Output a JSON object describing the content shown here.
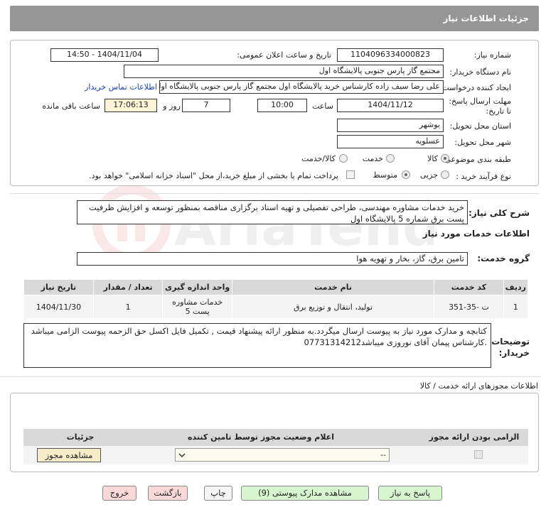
{
  "header": {
    "title": "جزئیات اطلاعات نیاز"
  },
  "form": {
    "need_number_label": "شماره نیاز:",
    "need_number": "1104096334000823",
    "announce_label": "تاریخ و ساعت اعلان عمومی:",
    "announce_value": "1404/11/04 - 14:50",
    "buyer_org_label": "نام دستگاه خریدار:",
    "buyer_org": "مجتمع گاز پارس جنوبی  پالایشگاه اول",
    "creator_label": "ایجاد کننده درخواست:",
    "creator": "علی رضا سیف زاده کارشناس خرید پالایشگاه اول مجتمع گاز پارس جنوبی  پالایشگاه اول",
    "contact_link": "اطلاعات تماس خریدار",
    "deadline_label": "مهلت ارسال پاسخ: تا تاریخ:",
    "deadline_date": "1404/11/12",
    "time_label": "ساعت",
    "deadline_time": "10:00",
    "days": "7",
    "days_label": "روز و",
    "remaining_time": "17:06:13",
    "remaining_label": "ساعت باقی مانده",
    "province_label": "استان محل تحویل:",
    "province": "بوشهر",
    "city_label": "شهر محل تحویل:",
    "city": "عسلویه",
    "category_label": "طبقه بندی موضوعی:",
    "category_options": [
      "کالا",
      "خدمت",
      "کالا/خدمت"
    ],
    "purchase_type_label": "نوع فرآیند خرید :",
    "purchase_options": [
      "جزیی",
      "متوسط"
    ],
    "payment_note": "پرداخت تمام یا بخشی از مبلغ خرید،از محل \"اسناد خزانه اسلامی\" خواهد بود."
  },
  "description": {
    "label": "شرح کلی نیاز:",
    "text": "خرید خدمات مشاوره مهندسی، طراحی تفصیلی و تهیه اسناد برگزاری مناقصه بمنظور توسعه و افزایش ظرفیت پست برق شماره 5 پالایشگاه اول"
  },
  "services": {
    "section_title": "اطلاعات خدمات مورد نیاز",
    "group_label": "گروه خدمت:",
    "group_value": "تامین برق، گاز، بخار و تهویه هوا",
    "headers": [
      "ردیف",
      "کد خدمت",
      "نام خدمت",
      "واحد اندازه گیری",
      "تعداد / مقدار",
      "تاریخ نیاز"
    ],
    "rows": [
      {
        "row": "1",
        "code": "ت -35-351",
        "name": "تولید، انتقال و توزیع برق",
        "unit": "خدمات مشاوره پست 5",
        "qty": "1",
        "date": "1404/11/30"
      }
    ]
  },
  "buyer_notes": {
    "label": "توضیحات خریدار:",
    "text": "کتابچه و مدارک مورد نیاز به پیوست ارسال میگردد.به منظور ارائه پیشنهاد قیمت , تکمیل فایل اکسل حق الزحمه پیوست الزامی میباشد .کارشناس پیمان آقای نوروزی میباشد07731314212"
  },
  "permits": {
    "title": "اطلاعات مجوزهای ارائه خدمت / کالا",
    "headers": [
      "الزامی بودن ارائه مجوز",
      "اعلام وضعیت مجوز توسط تامین کننده",
      "جزئیات"
    ],
    "select_value": "--",
    "view_button": "مشاهده مجوز"
  },
  "footer": {
    "reply": "پاسخ به نیاز",
    "docs": "مشاهده مدارک پیوستی (9)",
    "print": "چاپ",
    "back": "بازگشت",
    "exit": "خروج"
  },
  "watermark": "AriaTender.net",
  "colors": {
    "header_bg": "#969696",
    "green_btn": "#d7f5cf",
    "pink_btn": "#fbd9d9",
    "remaining_bg": "#fdf5d6"
  }
}
